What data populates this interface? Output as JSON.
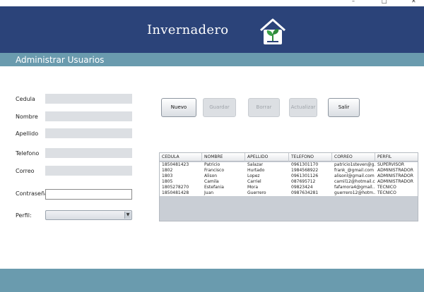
{
  "window": {
    "minimize": "–",
    "maximize": "□",
    "close": "✕"
  },
  "header": {
    "title": "Invernadero",
    "logo_icon": "greenhouse-plant-icon"
  },
  "subheader": {
    "title": "Administrar Usuarios"
  },
  "form": {
    "cedula_label": "Cedula",
    "nombre_label": "Nombre",
    "apellido_label": "Apellido",
    "telefono_label": "Telefono",
    "correo_label": "Correo",
    "contrasena_label": "Contraseña",
    "perfil_label": "Perfil:",
    "cedula_value": "",
    "nombre_value": "",
    "apellido_value": "",
    "telefono_value": "",
    "correo_value": "",
    "contrasena_value": "",
    "perfil_selected": ""
  },
  "buttons": {
    "nuevo": "Nuevo",
    "guardar": "Guardar",
    "borrar": "Borrar",
    "actualizar": "Actualizar",
    "salir": "Salir"
  },
  "table": {
    "headers": [
      "CEDULA",
      "NOMBRE",
      "APELLIDO",
      "TELEFONO",
      "CORREO",
      "PERFIL"
    ],
    "rows": [
      [
        "1850481423",
        "Patricio",
        "Salazar",
        "0961301170",
        "patricio1steven@g...",
        "SUPERVISOR"
      ],
      [
        "1802",
        "Francisco",
        "Hurtado",
        "1984568922",
        "frank_@gmail.com",
        "ADMINISTRADOR"
      ],
      [
        "1803",
        "Alison",
        "Lopez",
        "0961301126",
        "alisonl@gmail.com",
        "ADMINISTRADOR"
      ],
      [
        "1805",
        "Camila",
        "Carriel",
        "087695712",
        "camil12@hotmail.c...",
        "ADMINISTRADOR"
      ],
      [
        "1805278270",
        "Estefania",
        "Mora",
        "09823424",
        "fafamora4@gmail....",
        "TECNICO"
      ],
      [
        "1850481428",
        "Juan",
        "Guerrero",
        "0987634281",
        "guerrero12@hotm...",
        "TECNICO"
      ]
    ]
  },
  "colors": {
    "header": "#2b4379",
    "subheader": "#6a9bae",
    "footer": "#6a9bae",
    "field": "#dcdfe3"
  }
}
